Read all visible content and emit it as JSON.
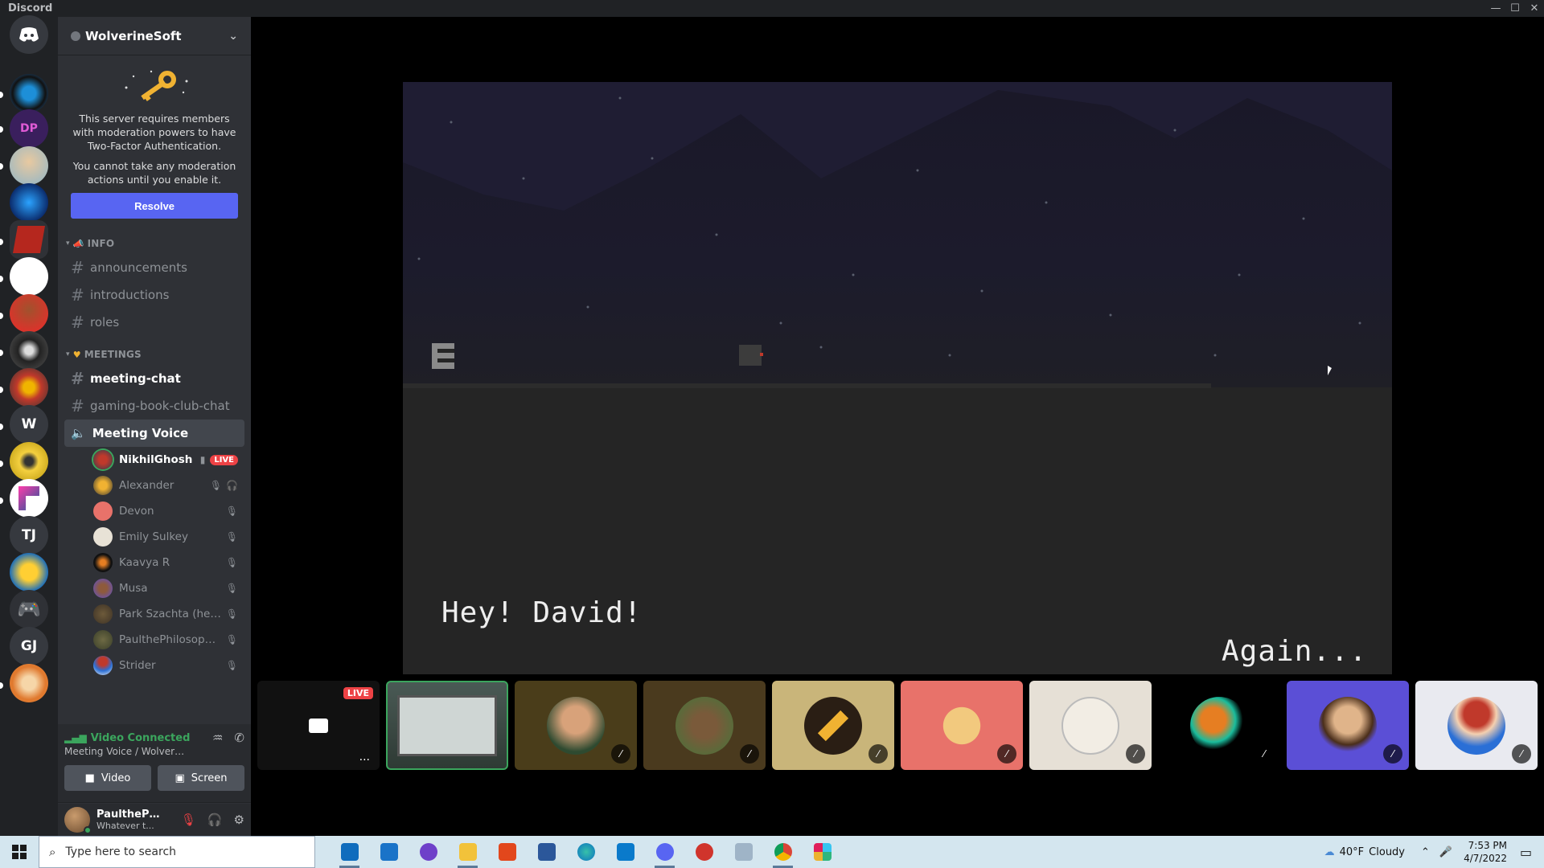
{
  "window": {
    "title": "Discord"
  },
  "server": {
    "name": "WolverineSoft"
  },
  "rail": {
    "letter_servers": [
      "W",
      "TJ",
      "GJ"
    ]
  },
  "mfa": {
    "line1": "This server requires members with moderation powers to have Two-Factor Authentication.",
    "line2": "You cannot take any moderation actions until you enable it.",
    "resolve_label": "Resolve"
  },
  "categories": {
    "info": "INFO",
    "meetings": "MEETINGS"
  },
  "channels": {
    "announcements": "announcements",
    "introductions": "introductions",
    "roles": "roles",
    "meeting_chat": "meeting-chat",
    "gaming_book_club_chat": "gaming-book-club-chat",
    "meeting_voice": "Meeting Voice"
  },
  "voice_users": [
    {
      "name": "NikhilGhosh",
      "badge": "LIVE"
    },
    {
      "name": "Alexander"
    },
    {
      "name": "Devon"
    },
    {
      "name": "Emily Sulkey"
    },
    {
      "name": "Kaavya R"
    },
    {
      "name": "Musa"
    },
    {
      "name": "Park Szachta (he/hi..."
    },
    {
      "name": "PaulthePhilosopher"
    },
    {
      "name": "Strider"
    }
  ],
  "voice_panel": {
    "status": "Video Connected",
    "location": "Meeting Voice / Wolverine...",
    "video_label": "Video",
    "screen_label": "Screen"
  },
  "user_panel": {
    "username": "PaulthePhil...",
    "status": "Whatever t..."
  },
  "stream": {
    "dialog_left": "Hey! David!",
    "dialog_right": "Again..."
  },
  "tiles": {
    "live_badge": "LIVE",
    "more": "..."
  },
  "taskbar": {
    "search_placeholder": "Type here to search",
    "temperature": "40°F",
    "condition": "Cloudy",
    "time": "7:53 PM",
    "date": "4/7/2022"
  },
  "colors": {
    "blurple": "#5865f2",
    "green": "#3ba55d",
    "red": "#ed4245"
  }
}
